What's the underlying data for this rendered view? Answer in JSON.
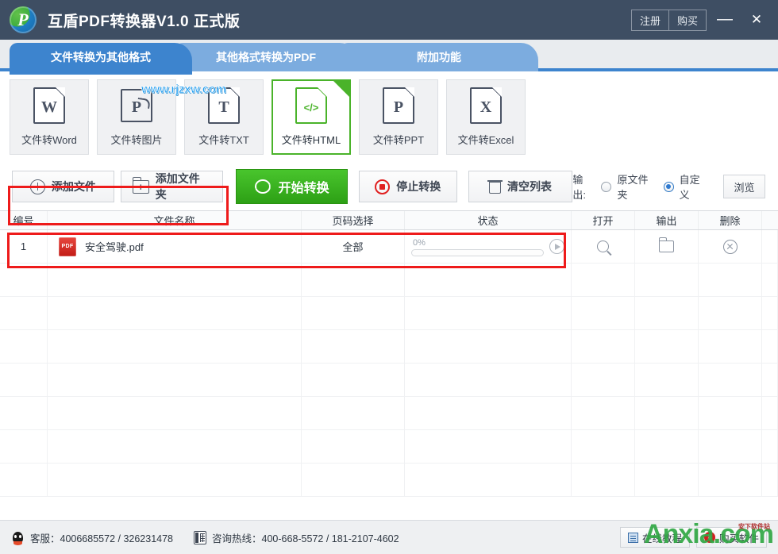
{
  "titlebar": {
    "app_title": "互盾PDF转换器V1.0 正式版",
    "logo_letter": "P",
    "register_label": "注册",
    "buy_label": "购买",
    "minimize_label": "—",
    "close_label": "✕"
  },
  "tabs": [
    {
      "label": "文件转换为其他格式",
      "active": true
    },
    {
      "label": "其他格式转换为PDF",
      "active": false
    },
    {
      "label": "附加功能",
      "active": false
    }
  ],
  "watermarks": {
    "top": "www.rjzxw.com",
    "bottom": "Anxia.com",
    "bottom_sub": "安下软件站"
  },
  "formats": [
    {
      "label": "文件转Word",
      "glyph": "W",
      "icon": "doc-word-icon",
      "active": false
    },
    {
      "label": "文件转图片",
      "glyph": "P",
      "icon": "doc-image-icon",
      "active": false
    },
    {
      "label": "文件转TXT",
      "glyph": "T",
      "icon": "doc-txt-icon",
      "active": false
    },
    {
      "label": "文件转HTML",
      "glyph": "</>",
      "icon": "doc-html-icon",
      "active": true
    },
    {
      "label": "文件转PPT",
      "glyph": "P",
      "icon": "doc-ppt-icon",
      "active": false
    },
    {
      "label": "文件转Excel",
      "glyph": "X",
      "icon": "doc-excel-icon",
      "active": false
    }
  ],
  "toolbar": {
    "add_file_label": "添加文件",
    "add_folder_label": "添加文件夹",
    "start_label": "开始转换",
    "stop_label": "停止转换",
    "clear_label": "清空列表",
    "output_label": "输出:",
    "output_original_label": "原文件夹",
    "output_custom_label": "自定义",
    "output_selected": "自定义",
    "browse_label": "浏览"
  },
  "table": {
    "headers": [
      "编号",
      "文件名称",
      "页码选择",
      "状态",
      "打开",
      "输出",
      "删除"
    ],
    "rows": [
      {
        "index": "1",
        "filename": "安全驾驶.pdf",
        "filetype": "PDF",
        "pages": "全部",
        "progress_text": "0%",
        "progress_value": 0
      }
    ],
    "empty_row_count": 7
  },
  "footer": {
    "support_label": "客服：4006685572 / 326231478",
    "hotline_label": "咨询热线：400-668-5572 / 181-2107-4602",
    "tutorial_label": "在线教程",
    "buy_software_label": "购买软件"
  },
  "colors": {
    "titlebar": "#3e4e63",
    "tab_active": "#3d84ce",
    "tab_inactive": "#7cacdf",
    "accent_green": "#2da015",
    "highlight_red": "#ee1b1b",
    "radio_blue": "#2f7ad0"
  }
}
